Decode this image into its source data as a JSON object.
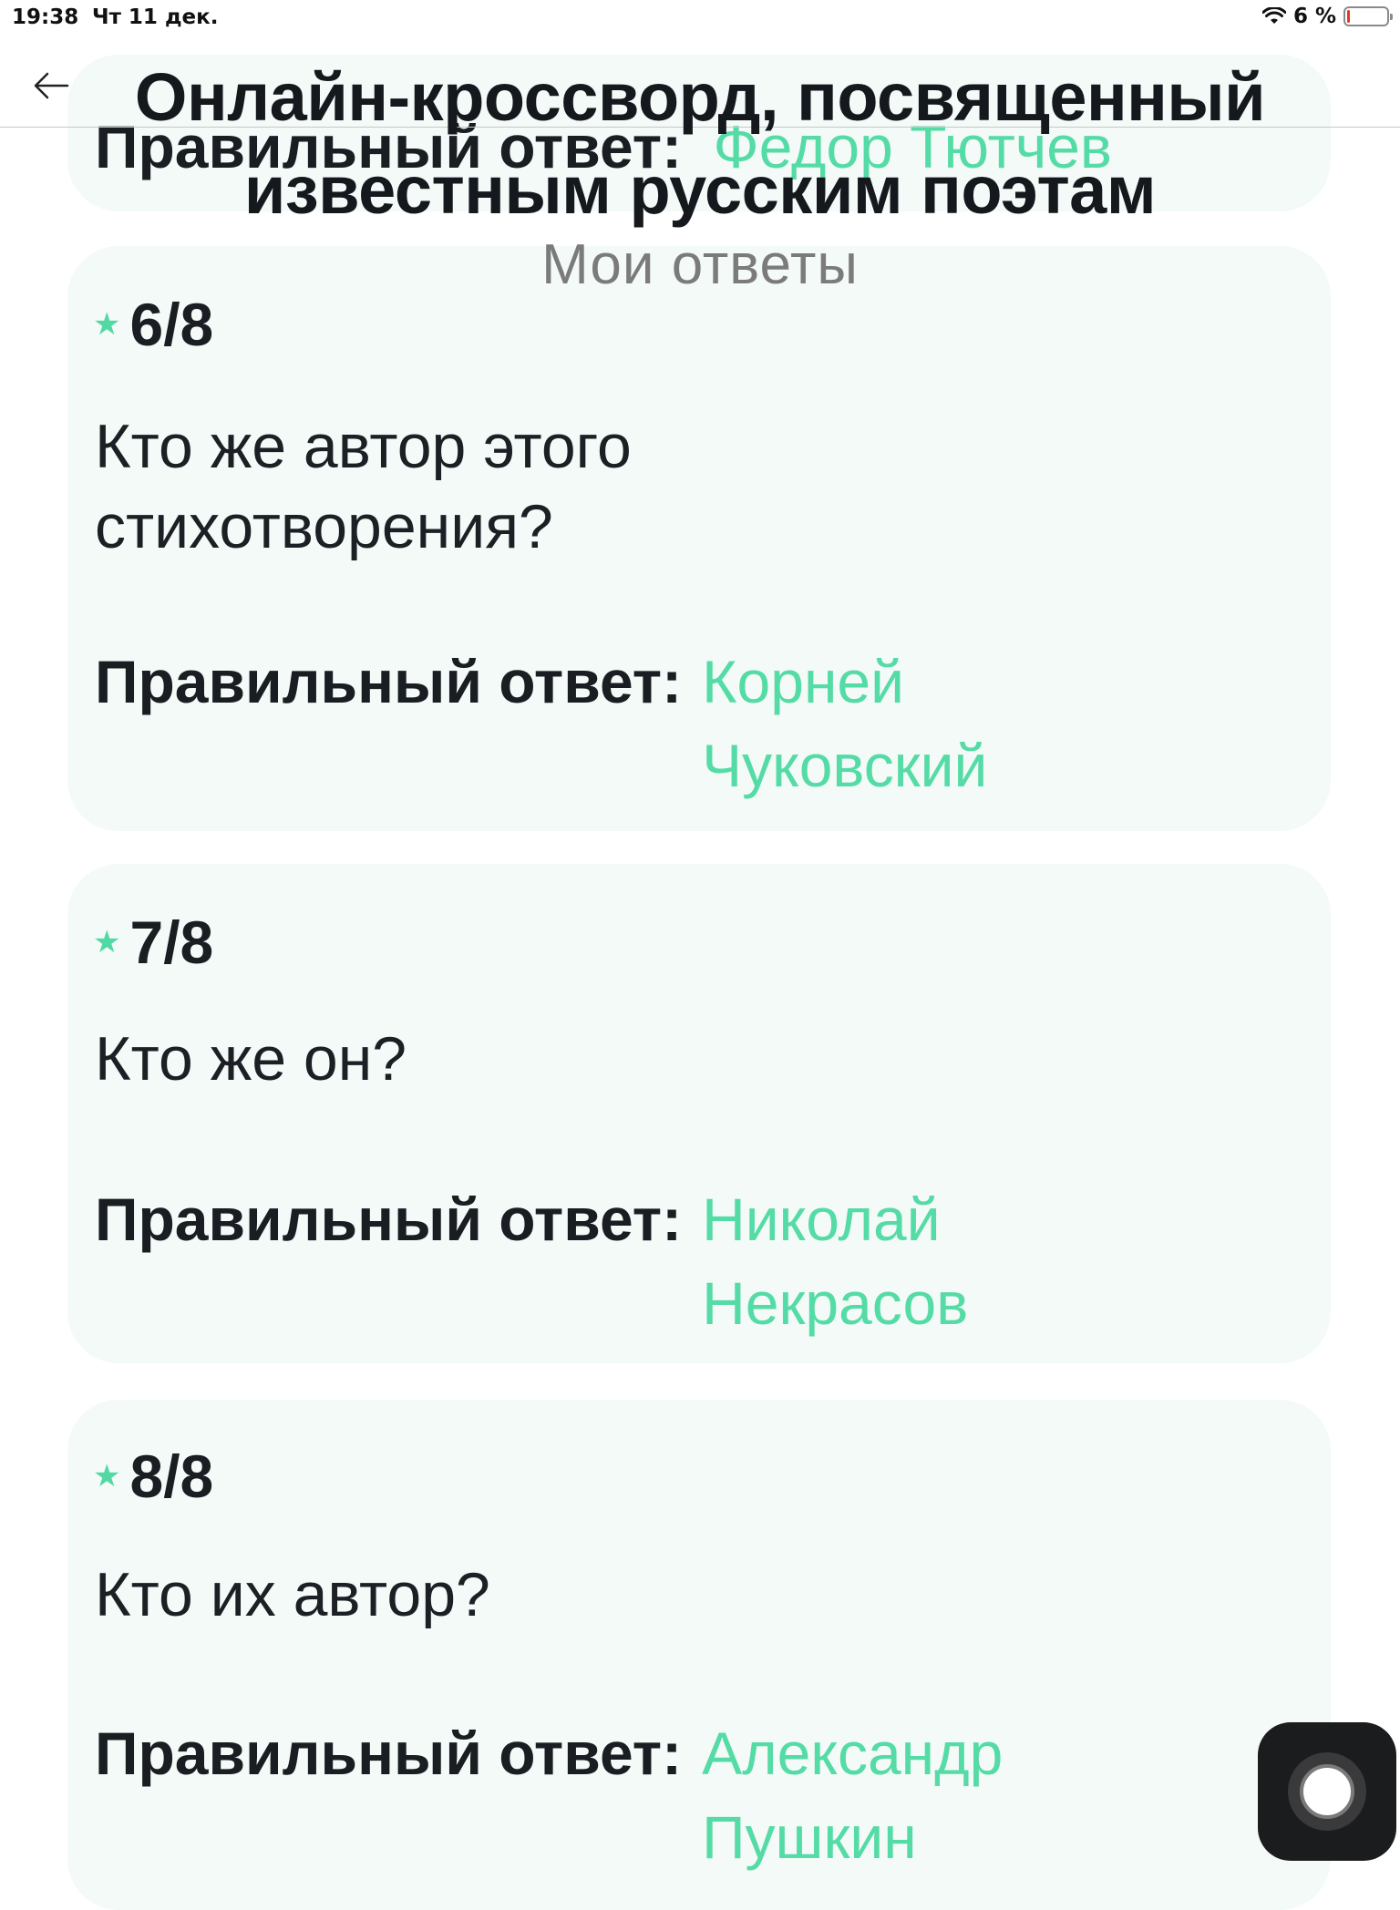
{
  "status_bar": {
    "time": "19:38",
    "date": "Чт 11 дек.",
    "battery": "6 %",
    "battery_level_percent": 6
  },
  "header": {
    "title": "Онлайн-кроссворд, посвященный известным русским поэтам",
    "subtitle": "Мои ответы"
  },
  "previous_answer": {
    "label": "Правильный ответ:",
    "value": "Федор Тютчев"
  },
  "questions": [
    {
      "number": "6/8",
      "text": "Кто же автор этого стихотворения?",
      "answer_label": "Правильный ответ:",
      "answer_value": "Корней Чуковский"
    },
    {
      "number": "7/8",
      "text": "Кто же он?",
      "answer_label": "Правильный ответ:",
      "answer_value": "Николай Некрасов"
    },
    {
      "number": "8/8",
      "text": "Кто их автор?",
      "answer_label": "Правильный ответ:",
      "answer_value": "Александр Пушкин"
    }
  ],
  "colors": {
    "accent": "#55dba5",
    "card_background": "#f3faf8",
    "text": "#1a1d21",
    "subtitle": "#7b7b7b"
  },
  "icons": {
    "back": "arrow-left-icon",
    "star": "star-icon",
    "wifi": "wifi-icon",
    "battery": "battery-icon",
    "assistive_touch": "assistive-touch-icon"
  }
}
